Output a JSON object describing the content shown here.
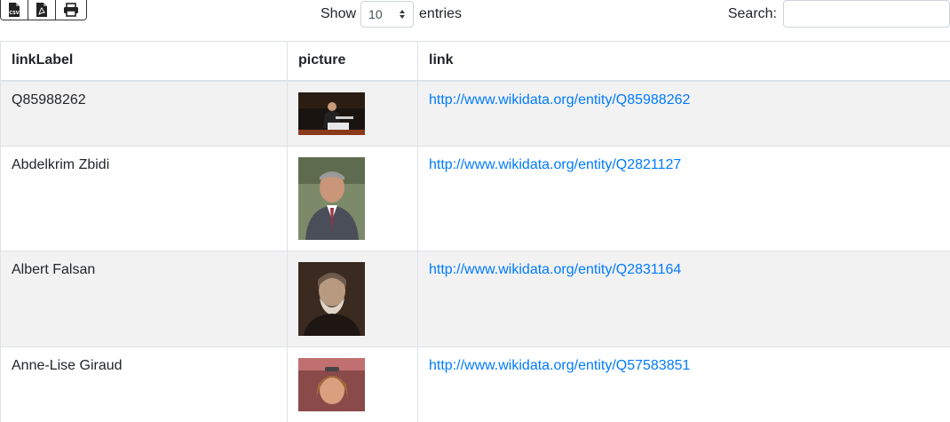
{
  "toolbar": {
    "export_buttons": [
      {
        "icon": "csv-file-icon"
      },
      {
        "icon": "pdf-file-icon"
      },
      {
        "icon": "print-icon"
      }
    ]
  },
  "length": {
    "show_label": "Show",
    "selected": "10",
    "entries_label": "entries"
  },
  "search": {
    "label": "Search:",
    "value": ""
  },
  "table": {
    "headers": [
      "linkLabel",
      "picture",
      "link"
    ],
    "rows": [
      {
        "label": "Q85988262",
        "picture": "portrait of man at lectern",
        "link": "http://www.wikidata.org/entity/Q85988262"
      },
      {
        "label": "Abdelkrim Zbidi",
        "picture": "portrait of man in suit",
        "link": "http://www.wikidata.org/entity/Q2821127"
      },
      {
        "label": "Albert Falsan",
        "picture": "sepia portrait of bearded man",
        "link": "http://www.wikidata.org/entity/Q2831164"
      },
      {
        "label": "Anne-Lise Giraud",
        "picture": "portrait of woman",
        "link": "http://www.wikidata.org/entity/Q57583851"
      }
    ]
  },
  "colors": {
    "link": "#007bff",
    "stripe": "#f2f2f2",
    "border": "#dee2e6"
  }
}
